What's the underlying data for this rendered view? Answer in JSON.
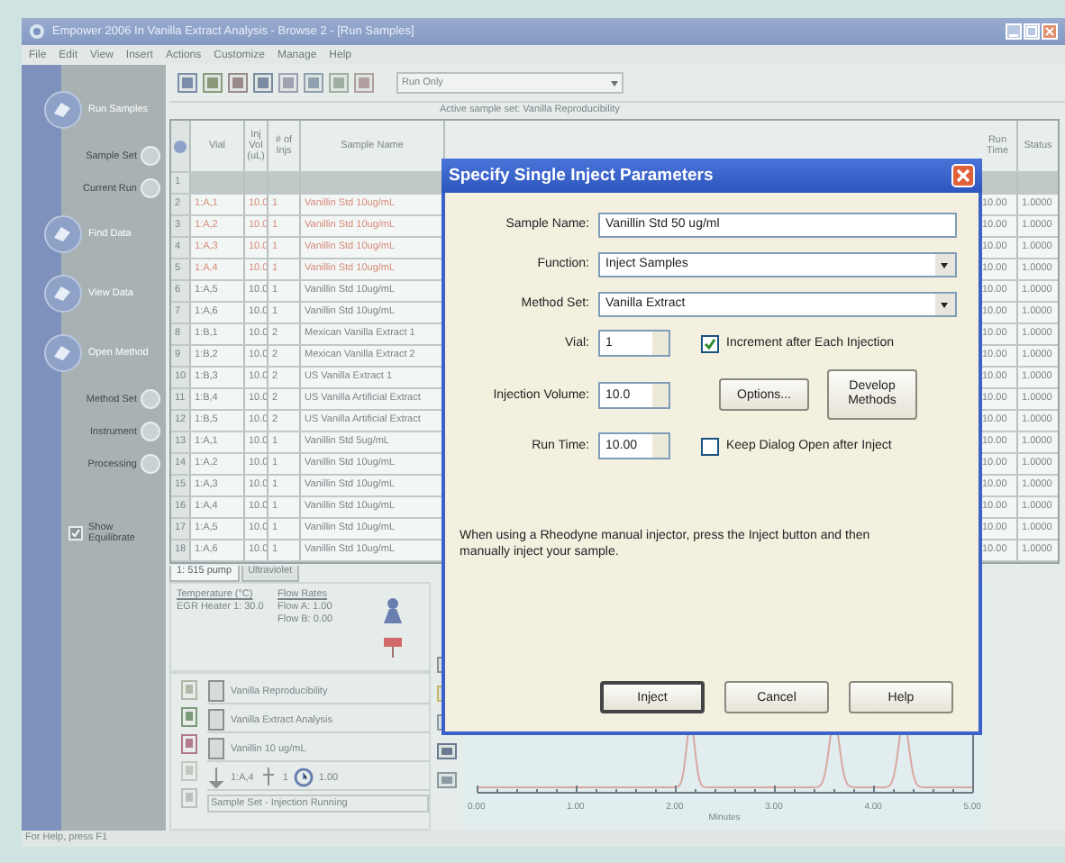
{
  "window": {
    "title": "Empower 2006 In Vanilla Extract Analysis - Browse 2 - [Run Samples]"
  },
  "menu": [
    "File",
    "Edit",
    "View",
    "Insert",
    "Actions",
    "Customize",
    "Manage",
    "Help"
  ],
  "sidebar": {
    "items": [
      {
        "kind": "main",
        "label": "Run Samples"
      },
      {
        "kind": "sub",
        "label": "Sample Set"
      },
      {
        "kind": "sub",
        "label": "Current Run"
      },
      {
        "kind": "main",
        "label": "Find Data"
      },
      {
        "kind": "main",
        "label": "View Data"
      },
      {
        "kind": "main",
        "label": "Open Method"
      },
      {
        "kind": "sub",
        "label": "Method Set"
      },
      {
        "kind": "sub",
        "label": "Instrument"
      },
      {
        "kind": "sub",
        "label": "Processing"
      },
      {
        "kind": "check",
        "label": "Show Equilibrate",
        "checked": true
      }
    ]
  },
  "toolbar": {
    "run_mode": "Run Only"
  },
  "sample_set_line": "Active sample set: Vanilla Reproducibility",
  "table": {
    "columns": [
      "Vial",
      "Inj Vol (uL)",
      "# of Injs",
      "Sample Name"
    ],
    "right_columns": [
      "Run Time",
      "Status"
    ],
    "rows": [
      {
        "num": "1",
        "vial": "",
        "volume": "",
        "injs": "",
        "name": "",
        "col_a": "",
        "col_b": "",
        "highlighted": true,
        "injected": false
      },
      {
        "num": "2",
        "vial": "1:A,1",
        "volume": "10.0",
        "injs": "1",
        "name": "Vanillin Std 10ug/mL",
        "col_a": "10.00",
        "col_b": "1.0000",
        "highlighted": false,
        "injected": true
      },
      {
        "num": "3",
        "vial": "1:A,2",
        "volume": "10.0",
        "injs": "1",
        "name": "Vanillin Std 10ug/mL",
        "col_a": "10.00",
        "col_b": "1.0000",
        "highlighted": false,
        "injected": true
      },
      {
        "num": "4",
        "vial": "1:A,3",
        "volume": "10.0",
        "injs": "1",
        "name": "Vanillin Std 10ug/mL",
        "col_a": "10.00",
        "col_b": "1.0000",
        "highlighted": false,
        "injected": true
      },
      {
        "num": "5",
        "vial": "1:A,4",
        "volume": "10.0",
        "injs": "1",
        "name": "Vanillin Std 10ug/mL",
        "col_a": "10.00",
        "col_b": "1.0000",
        "highlighted": false,
        "injected": true
      },
      {
        "num": "6",
        "vial": "1:A,5",
        "volume": "10.0",
        "injs": "1",
        "name": "Vanillin Std 10ug/mL",
        "col_a": "10.00",
        "col_b": "1.0000",
        "highlighted": false,
        "injected": false
      },
      {
        "num": "7",
        "vial": "1:A,6",
        "volume": "10.0",
        "injs": "1",
        "name": "Vanillin Std 10ug/mL",
        "col_a": "10.00",
        "col_b": "1.0000",
        "highlighted": false,
        "injected": false
      },
      {
        "num": "8",
        "vial": "1:B,1",
        "volume": "10.0",
        "injs": "2",
        "name": "Mexican Vanilla Extract 1",
        "col_a": "10.00",
        "col_b": "1.0000",
        "highlighted": false,
        "injected": false
      },
      {
        "num": "9",
        "vial": "1:B,2",
        "volume": "10.0",
        "injs": "2",
        "name": "Mexican Vanilla Extract 2",
        "col_a": "10.00",
        "col_b": "1.0000",
        "highlighted": false,
        "injected": false
      },
      {
        "num": "10",
        "vial": "1:B,3",
        "volume": "10.0",
        "injs": "2",
        "name": "US Vanilla Extract 1",
        "col_a": "10.00",
        "col_b": "1.0000",
        "highlighted": false,
        "injected": false
      },
      {
        "num": "11",
        "vial": "1:B,4",
        "volume": "10.0",
        "injs": "2",
        "name": "US Vanilla Artificial Extract",
        "col_a": "10.00",
        "col_b": "1.0000",
        "highlighted": false,
        "injected": false
      },
      {
        "num": "12",
        "vial": "1:B,5",
        "volume": "10.0",
        "injs": "2",
        "name": "US Vanilla Artificial Extract",
        "col_a": "10.00",
        "col_b": "1.0000",
        "highlighted": false,
        "injected": false
      },
      {
        "num": "13",
        "vial": "1:A,1",
        "volume": "10.0",
        "injs": "1",
        "name": "Vanillin Std 5ug/mL",
        "col_a": "10.00",
        "col_b": "1.0000",
        "highlighted": false,
        "injected": false
      },
      {
        "num": "14",
        "vial": "1:A,2",
        "volume": "10.0",
        "injs": "1",
        "name": "Vanillin Std 10ug/mL",
        "col_a": "10.00",
        "col_b": "1.0000",
        "highlighted": false,
        "injected": false
      },
      {
        "num": "15",
        "vial": "1:A,3",
        "volume": "10.0",
        "injs": "1",
        "name": "Vanillin Std 10ug/mL",
        "col_a": "10.00",
        "col_b": "1.0000",
        "highlighted": false,
        "injected": false
      },
      {
        "num": "16",
        "vial": "1:A,4",
        "volume": "10.0",
        "injs": "1",
        "name": "Vanillin Std 10ug/mL",
        "col_a": "10.00",
        "col_b": "1.0000",
        "highlighted": false,
        "injected": false
      },
      {
        "num": "17",
        "vial": "1:A,5",
        "volume": "10.0",
        "injs": "1",
        "name": "Vanillin Std 10ug/mL",
        "col_a": "10.00",
        "col_b": "1.0000",
        "highlighted": false,
        "injected": false
      },
      {
        "num": "18",
        "vial": "1:A,6",
        "volume": "10.0",
        "injs": "1",
        "name": "Vanillin Std 10ug/mL",
        "col_a": "10.00",
        "col_b": "1.0000",
        "highlighted": false,
        "injected": false
      }
    ]
  },
  "panel_tabs": [
    {
      "label": "1: 515 pump",
      "selected": true
    },
    {
      "label": "Ultraviolet",
      "selected": false
    }
  ],
  "status_panel": {
    "temperature_title": "Temperature (°C)",
    "temperature": "EGR Heater 1: 30.0",
    "flow_title": "Flow Rates",
    "flows": [
      "Flow A: 1.00",
      "Flow B: 0.00"
    ]
  },
  "run_info": {
    "items": [
      "Vanilla Reproducibility",
      "Vanilla Extract Analysis",
      "Vanillin 10 ug/mL"
    ],
    "vial": "1:A,4",
    "injection": "1",
    "time": "1.00",
    "state": "Sample Set - Injection Running"
  },
  "chart_ticks": [
    "0.00",
    "1.00",
    "2.00",
    "3.00",
    "4.00",
    "5.00"
  ],
  "chart_xlabel": "Minutes",
  "status_bar": "For Help, press F1",
  "dialog": {
    "title": "Specify Single Inject Parameters",
    "fields": [
      {
        "kind": "text",
        "label": "Sample Name:",
        "value": "Vanillin Std 50 ug/ml"
      },
      {
        "kind": "select",
        "label": "Function:",
        "value": "Inject Samples"
      },
      {
        "kind": "select",
        "label": "Method Set:",
        "value": "Vanilla Extract"
      },
      {
        "kind": "spin",
        "label": "Vial:",
        "value": "1",
        "checkbox": {
          "label": "Increment after Each Injection",
          "checked": true
        }
      },
      {
        "kind": "spin",
        "label": "Injection Volume:",
        "value": "10.0",
        "buttons": [
          "Options...",
          "Develop Methods"
        ]
      },
      {
        "kind": "spin",
        "label": "Run Time:",
        "value": "10.00",
        "checkbox": {
          "label": "Keep Dialog Open after Inject",
          "checked": false
        }
      }
    ],
    "note": "When using a Rheodyne manual injector, press the Inject button and then manually inject your sample.",
    "buttons": [
      {
        "label": "Inject",
        "default": true
      },
      {
        "label": "Cancel",
        "default": false
      },
      {
        "label": "Help",
        "default": false
      }
    ]
  }
}
